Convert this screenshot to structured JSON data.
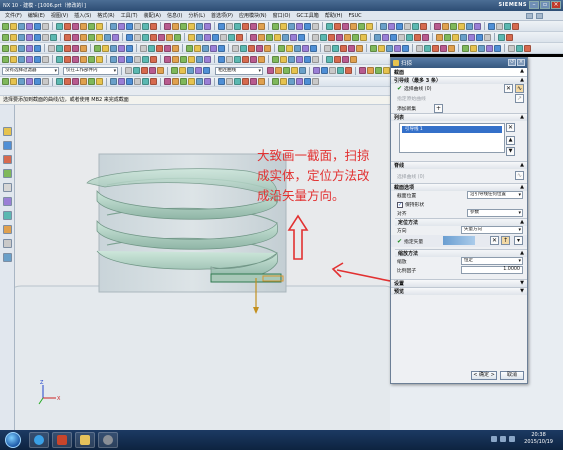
{
  "titlebar": {
    "title": "NX 10 - 建模 - [1006.prt（修改的）]",
    "brand": "SIEMENS"
  },
  "menubar": {
    "items": [
      "文件(F)",
      "编辑(E)",
      "视图(V)",
      "插入(S)",
      "格式(R)",
      "工具(T)",
      "装配(A)",
      "信息(I)",
      "分析(L)",
      "首选项(P)",
      "应用模块(N)",
      "窗口(O)",
      "GC工具箱",
      "帮助(H)",
      "FSUC"
    ]
  },
  "selectionbar": {
    "filter": "没有选择过滤器",
    "scope": "仅在工作部件内",
    "intent": "相连曲线"
  },
  "prompt": "选择要添加到截面的曲线/边，或者使用 MB2 来完成截面",
  "annotation": {
    "line1": "大致画一截面，扫掠",
    "line2": "成实体，定位方法改",
    "line3": "成沿矢量方向。"
  },
  "dialog": {
    "title": "扫掠",
    "guides_section": "引导线（最多 3 条）",
    "select_curve": "选择曲线 (0)",
    "specify_origin": "指定原始曲线",
    "add_new_set": "添加新集",
    "list_section": "列表",
    "list_item": "引导线 1",
    "spine_section": "脊线",
    "spine_select": "选择曲线 (0)",
    "section_options": "截面选项",
    "section_position_label": "截面位置",
    "section_position_value": "沿引导线任何位置",
    "keep_shape": "保持形状",
    "alignment_label": "对齐",
    "alignment_value": "参数",
    "orientation_section": "定位方法",
    "direction_label": "方向",
    "direction_value": "矢量方向",
    "specify_vector": "指定矢量",
    "scaling_section": "缩放方法",
    "scale_label": "缩放",
    "scale_value": "恒定",
    "scale_factor_label": "比例因子",
    "scale_factor_value": "1.0000",
    "settings_section": "设置",
    "preview_section": "预览",
    "ok_button": "< 确定 >",
    "cancel_button": "取消"
  },
  "taskbar": {
    "time": "20:38",
    "date": "2015/10/19"
  },
  "colors": {
    "annotation": "#e23131",
    "helix": "#b9d9cc",
    "selection_highlight": "#3470c9"
  },
  "icons": [
    "nx-logo-icon",
    "windows-start-icon",
    "sogou-icon",
    "nx-app-icon",
    "folder-icon",
    "media-icon"
  ]
}
